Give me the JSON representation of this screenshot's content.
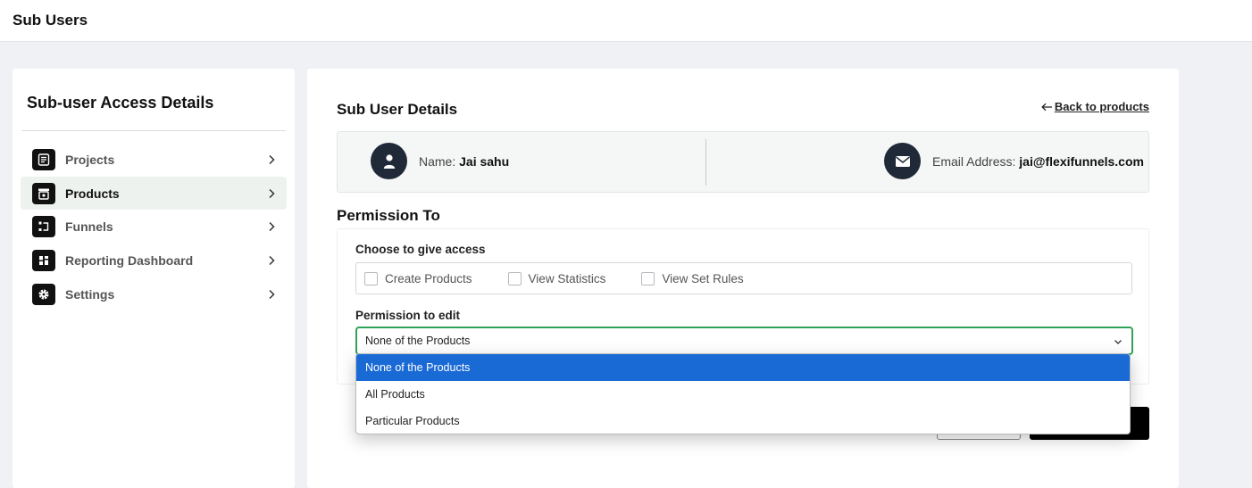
{
  "header": {
    "title": "Sub Users"
  },
  "sidebar": {
    "title": "Sub-user Access Details",
    "items": [
      {
        "label": "Projects",
        "icon": "document-icon",
        "active": false
      },
      {
        "label": "Products",
        "icon": "store-icon",
        "active": true
      },
      {
        "label": "Funnels",
        "icon": "funnel-icon",
        "active": false
      },
      {
        "label": "Reporting Dashboard",
        "icon": "dashboard-icon",
        "active": false
      },
      {
        "label": "Settings",
        "icon": "gear-icon",
        "active": false
      }
    ]
  },
  "main": {
    "title": "Sub User Details",
    "back_link": "Back to products",
    "name_label": "Name:",
    "name_value": "Jai sahu",
    "email_label": "Email Address:",
    "email_value": "jai@flexifunnels.com",
    "permission_title": "Permission To",
    "access_label": "Choose to give access",
    "checkboxes": [
      {
        "label": "Create Products",
        "checked": false
      },
      {
        "label": "View Statistics",
        "checked": false
      },
      {
        "label": "View Set Rules",
        "checked": false
      }
    ],
    "edit_label": "Permission to edit",
    "edit_select": {
      "value": "None of the Products",
      "options": [
        "None of the Products",
        "All Products",
        "Particular Products"
      ],
      "selected_index": 0
    }
  },
  "colors": {
    "accent_green": "#30a25a",
    "selected_blue": "#1a6ad6",
    "dark": "#1f2937"
  }
}
